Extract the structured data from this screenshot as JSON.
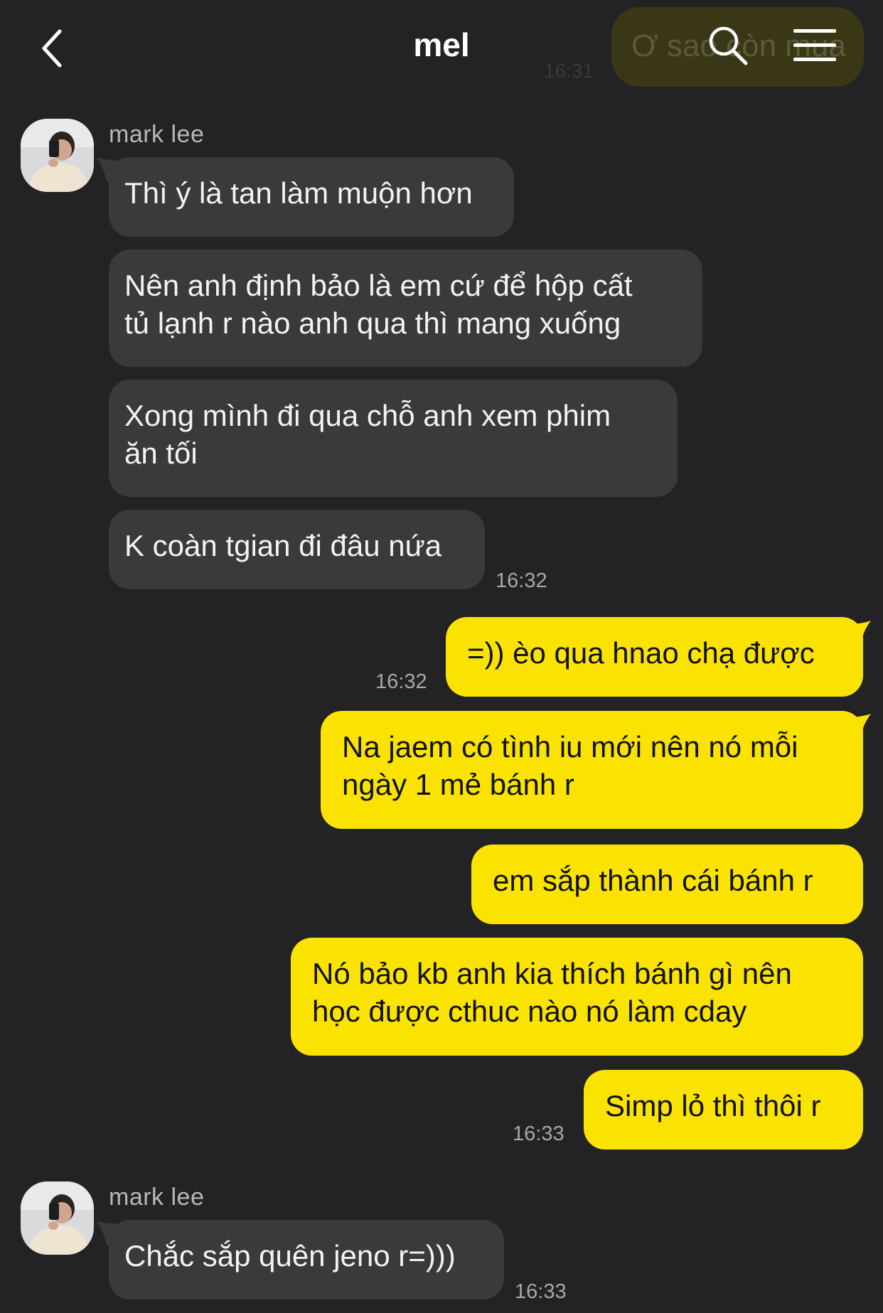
{
  "header": {
    "title": "mel"
  },
  "ghost": {
    "text": "Ơ sao còn mua",
    "time": "16:31"
  },
  "messages": [
    {
      "sender": "mark lee",
      "text": "Thì ý là tan làm muộn hơn"
    },
    {
      "line1": "Nên anh định bảo là em cứ để hộp cất",
      "line2": "tủ lạnh r nào anh qua thì mang xuống"
    },
    {
      "line1": "Xong mình đi qua chỗ anh xem phim",
      "line2": "ăn tối"
    },
    {
      "text": "K coàn tgian đi đâu nứa",
      "time": "16:32"
    },
    {
      "text": "=)) èo qua hnao chạ được",
      "time": "16:32"
    },
    {
      "line1": "Na jaem có tình iu mới nên nó mỗi",
      "line2": "ngày 1 mẻ bánh r"
    },
    {
      "text": "em sắp thành cái bánh r"
    },
    {
      "line1": "Nó bảo kb anh kia thích bánh gì nên",
      "line2": "học được cthuc nào nó làm cday"
    },
    {
      "text": "Simp lỏ thì thôi r",
      "time": "16:33"
    },
    {
      "sender": "mark lee",
      "text": "Chắc sắp quên jeno r=)))",
      "time": "16:33"
    }
  ],
  "colors": {
    "background": "#232326",
    "incoming_bubble": "#3a3a3d",
    "outgoing_bubble": "#fbe301",
    "timestamp": "#a7a7ab"
  },
  "icons": [
    "back-icon",
    "search-icon",
    "menu-icon"
  ]
}
